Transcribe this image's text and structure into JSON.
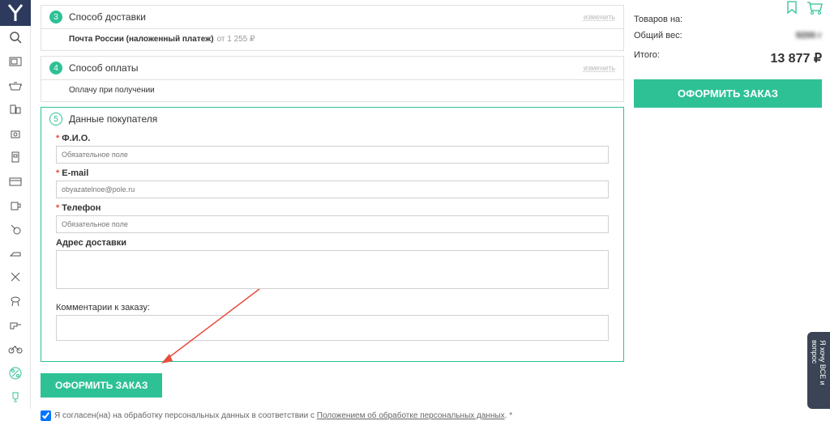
{
  "sections": {
    "delivery": {
      "num": "3",
      "title": "Способ доставки",
      "change": "изменить",
      "text_bold": "Почта России (наложенный платеж)",
      "text_gray": "от 1 255 ₽"
    },
    "payment": {
      "num": "4",
      "title": "Способ оплаты",
      "change": "изменить",
      "text": "Оплачу при получении"
    },
    "buyer": {
      "num": "5",
      "title": "Данные покупателя"
    }
  },
  "form": {
    "fio": {
      "label": "Ф.И.О.",
      "placeholder": "Обязательное поле"
    },
    "email": {
      "label": "E-mail",
      "placeholder": "obyazatelnoe@pole.ru"
    },
    "phone": {
      "label": "Телефон",
      "placeholder": "Обязательное поле"
    },
    "address": {
      "label": "Адрес доставки"
    },
    "comment": {
      "label": "Комментарии к заказу:"
    }
  },
  "buttons": {
    "submit": "ОФОРМИТЬ ЗАКАЗ",
    "big_submit": "ОФОРМИТЬ ЗАКАЗ"
  },
  "consent": {
    "text_before": "Я согласен(на) на обработку персональных данных в соответствии с ",
    "link": "Положением об обработке персональных данных",
    "text_after": ". *"
  },
  "summary": {
    "goods_label": "Товаров на:",
    "weight_label": "Общий вес:",
    "weight_value": "9200 г",
    "total_label": "Итого:",
    "total_value": "13 877 ₽"
  },
  "feedback": "Я хочу ВСЕ и вопрос"
}
